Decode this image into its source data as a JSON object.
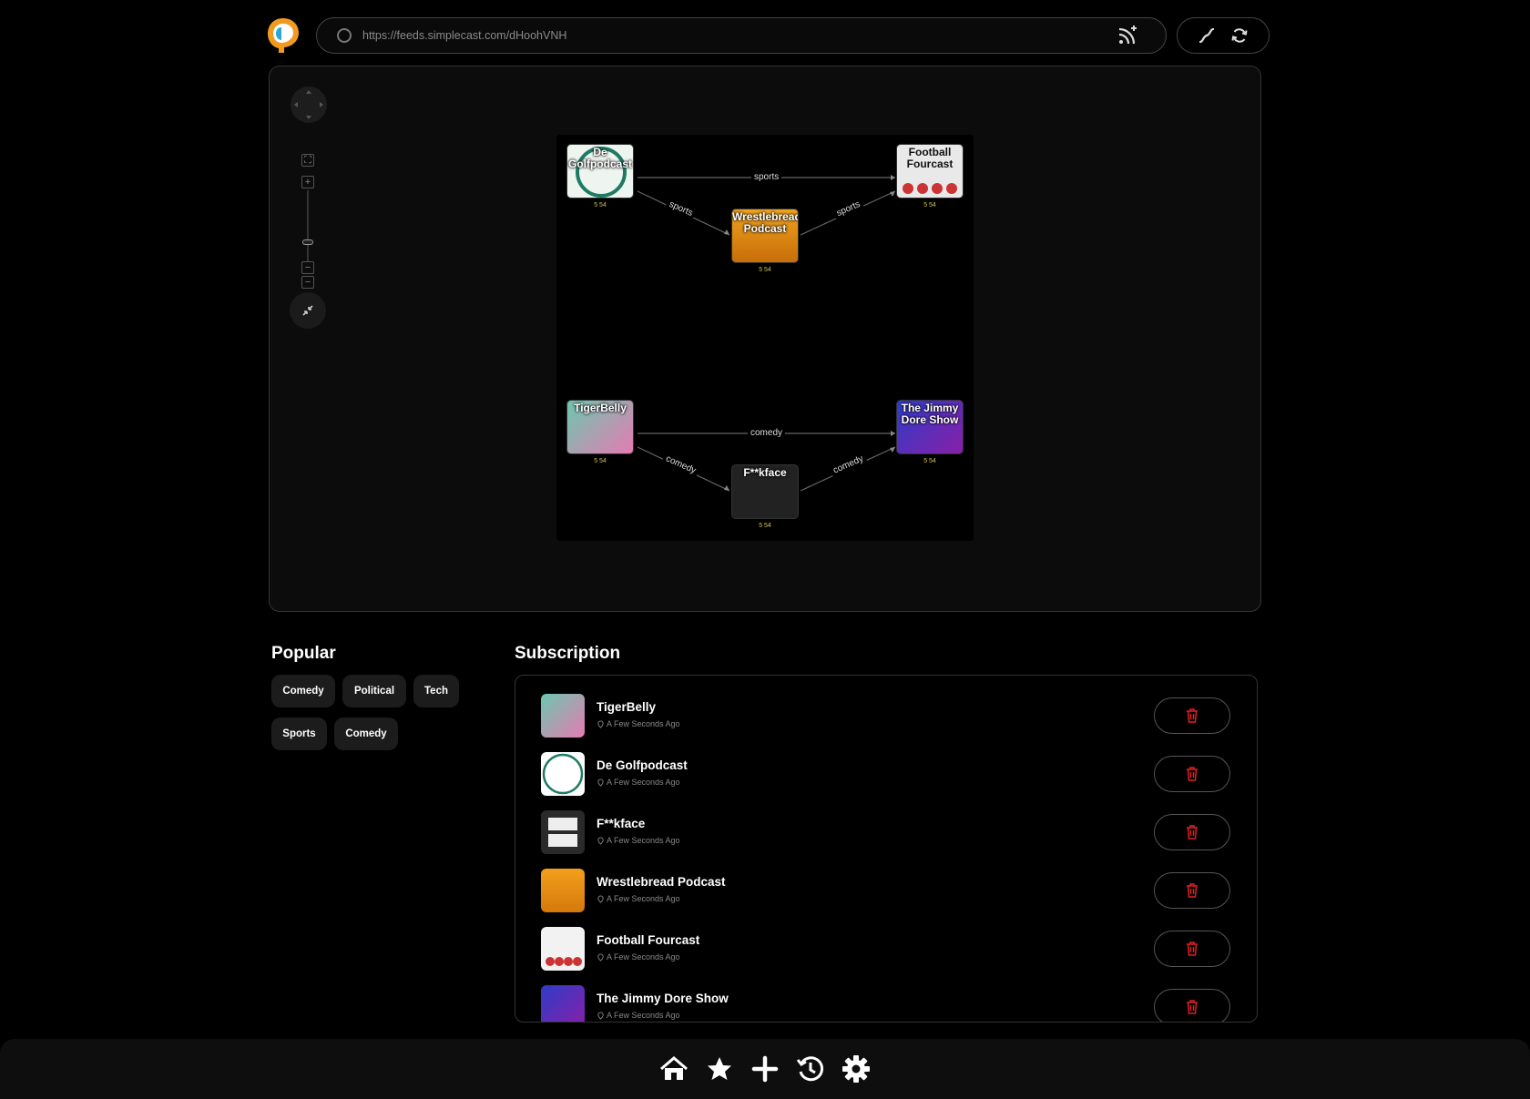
{
  "url_bar": {
    "value": "https://feeds.simplecast.com/dHoohVNH"
  },
  "graph": {
    "nodes": [
      {
        "id": "golf",
        "title": "De Golfpodcast",
        "stats": "5 54"
      },
      {
        "id": "football",
        "title": "Football Fourcast",
        "stats": "5 54"
      },
      {
        "id": "wrestle",
        "title": "Wrestlebread Podcast",
        "stats": "5 54"
      },
      {
        "id": "tiger",
        "title": "TigerBelly",
        "stats": "5 54"
      },
      {
        "id": "jimmy",
        "title": "The Jimmy Dore Show",
        "stats": "5 54"
      },
      {
        "id": "fface",
        "title": "F**kface",
        "stats": "5 54"
      }
    ],
    "edges": [
      {
        "label": "sports"
      },
      {
        "label": "sports"
      },
      {
        "label": "sports"
      },
      {
        "label": "comedy"
      },
      {
        "label": "comedy"
      },
      {
        "label": "comedy"
      }
    ]
  },
  "popular": {
    "title": "Popular",
    "tags": [
      "Comedy",
      "Political",
      "Tech",
      "Sports",
      "Comedy"
    ]
  },
  "subscription": {
    "title": "Subscription",
    "items": [
      {
        "name": "TigerBelly",
        "time": "A Few Seconds Ago"
      },
      {
        "name": "De Golfpodcast",
        "time": "A Few Seconds Ago"
      },
      {
        "name": "F**kface",
        "time": "A Few Seconds Ago"
      },
      {
        "name": "Wrestlebread Podcast",
        "time": "A Few Seconds Ago"
      },
      {
        "name": "Football Fourcast",
        "time": "A Few Seconds Ago"
      },
      {
        "name": "The Jimmy Dore Show",
        "time": "A Few Seconds Ago"
      }
    ]
  },
  "bottom_nav": [
    "home-icon",
    "star-icon",
    "plus-icon",
    "history-icon",
    "gear-icon"
  ],
  "colors": {
    "accent": "#f5a623",
    "delete": "#e02020",
    "background": "#000000"
  }
}
